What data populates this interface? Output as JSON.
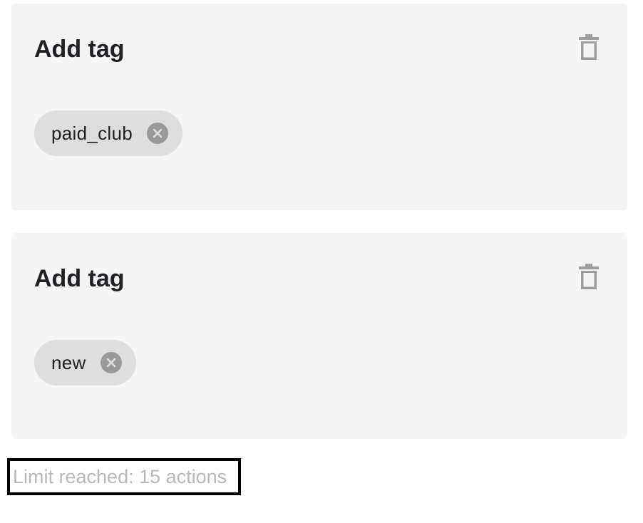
{
  "actions": [
    {
      "title": "Add tag",
      "delete_icon": "trash-icon",
      "tags": [
        {
          "label": "paid_club",
          "remove_icon": "close-circle-icon"
        }
      ]
    },
    {
      "title": "Add tag",
      "delete_icon": "trash-icon",
      "tags": [
        {
          "label": "new",
          "remove_icon": "close-circle-icon"
        }
      ]
    }
  ],
  "limit": {
    "text": "Limit reached: 15 actions"
  },
  "colors": {
    "card_background": "#f5f5f5",
    "chip_background": "#dedede",
    "chip_remove_background": "#9a9a9a",
    "icon_gray": "#9e9e9e",
    "title_text": "#202124",
    "limit_text": "#b8b8b8",
    "highlight_border": "#000000"
  }
}
